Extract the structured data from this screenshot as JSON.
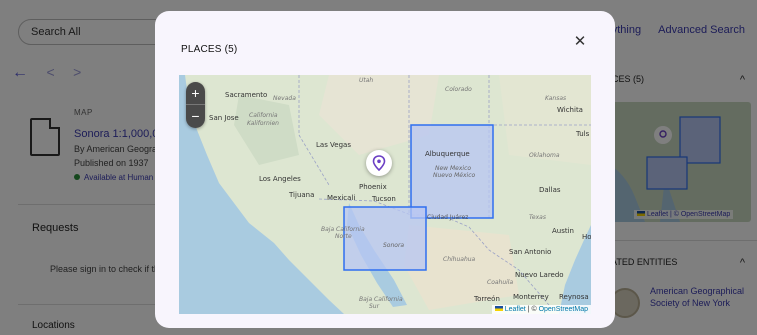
{
  "background": {
    "search_placeholder": "Search All",
    "top_links": [
      "Ask Anything",
      "Advanced Search"
    ],
    "nav": {
      "back": "←",
      "prev": "<",
      "next": ">"
    },
    "record": {
      "type_label": "MAP",
      "title": "Sonora 1:1,000,00",
      "by": "By American Geogra",
      "published": "Published on 1937",
      "availability": "Available at Human"
    },
    "requests_heading": "Requests",
    "requests_text": "Please sign in to check if th",
    "locations_heading": "Locations",
    "sidebar": {
      "places_heading": "ACES (5)",
      "related_heading": "LATED ENTITIES",
      "related_entity": "American Geographical Society of New York",
      "mini_attribution": "Leaflet | © OpenStreetMap"
    }
  },
  "modal": {
    "title": "PLACES (5)",
    "close_label": "✕",
    "zoom_in": "+",
    "zoom_out": "−",
    "attribution_leaflet": "Leaflet",
    "attribution_sep": " | © ",
    "attribution_osm": "OpenStreetMap",
    "map_labels": {
      "utah": "Utah",
      "colorado": "Colorado",
      "nevada": "Nevada",
      "kansas": "Kansas",
      "wichita": "Wichita",
      "sacramento": "Sacramento",
      "san_jose": "San Jose",
      "california": "California",
      "kalifornien": "Kalifornien",
      "las_vegas": "Las Vegas",
      "tulsa": "Tuls",
      "albuquerque": "Albuquerque",
      "oklahoma": "Oklahoma",
      "new_mexico": "New Mexico",
      "nuevo_mexico": "Nuevo México",
      "los_angeles": "Los Angeles",
      "phoenix": "Phoenix",
      "dallas": "Dallas",
      "tijuana": "Tijuana",
      "mexicali": "Mexicali",
      "tucson": "Tucson",
      "ciudad_juarez": "Ciudad Juárez",
      "texas": "Texas",
      "baja_california": "Baja California",
      "baja_norte": "Norte",
      "austin": "Austin",
      "houston": "Ho",
      "sonora": "Sonora",
      "chihuahua": "Chihuahua",
      "san_antonio": "San Antonio",
      "coahuila": "Coahuila",
      "nuevo_laredo": "Nuevo Laredo",
      "baja_california_sur": "Baja California",
      "sur": "Sur",
      "torreon": "Torreón",
      "monterrey": "Monterrey",
      "reynosa": "Reynosa"
    }
  },
  "colors": {
    "accent": "#3a3ab0",
    "region_fill": "#b7c6f3",
    "region_stroke": "#2f6ff0",
    "water": "#a9cbe0",
    "land": "#dde6d1"
  }
}
